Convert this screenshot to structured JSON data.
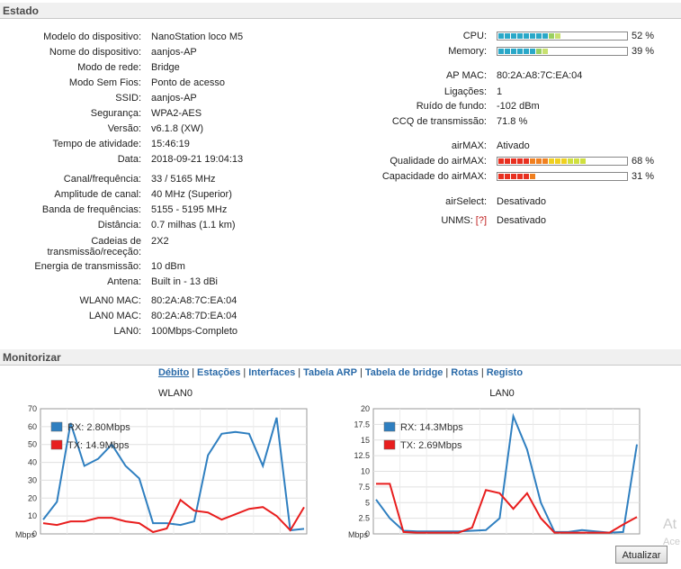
{
  "status": {
    "title": "Estado",
    "left": [
      {
        "label": "Modelo do dispositivo:",
        "value": "NanoStation loco M5"
      },
      {
        "label": "Nome do dispositivo:",
        "value": "aanjos-AP"
      },
      {
        "label": "Modo de rede:",
        "value": "Bridge"
      },
      {
        "label": "Modo Sem Fios:",
        "value": "Ponto de acesso"
      },
      {
        "label": "SSID:",
        "value": "aanjos-AP"
      },
      {
        "label": "Segurança:",
        "value": "WPA2-AES"
      },
      {
        "label": "Versão:",
        "value": "v6.1.8 (XW)"
      },
      {
        "label": "Tempo de atividade:",
        "value": "15:46:19"
      },
      {
        "label": "Data:",
        "value": "2018-09-21 19:04:13"
      },
      {
        "label": "Canal/frequência:",
        "value": "33 / 5165 MHz"
      },
      {
        "label": "Amplitude de canal:",
        "value": "40 MHz (Superior)"
      },
      {
        "label": "Banda de frequências:",
        "value": "5155 - 5195 MHz"
      },
      {
        "label": "Distância:",
        "value": "0.7 milhas (1.1 km)"
      },
      {
        "label": "Cadeias de",
        "label2": "transmissão/receção:",
        "value": "2X2"
      },
      {
        "label": "Energia de transmissão:",
        "value": "10 dBm"
      },
      {
        "label": "Antena:",
        "value": "Built in - 13 dBi"
      },
      {
        "label": "WLAN0 MAC:",
        "value": "80:2A:A8:7C:EA:04"
      },
      {
        "label": "LAN0 MAC:",
        "value": "80:2A:A8:7D:EA:04"
      },
      {
        "label": "LAN0:",
        "value": "100Mbps-Completo"
      }
    ],
    "cpu": {
      "label": "CPU:",
      "percent_text": "52 %",
      "percent": 52
    },
    "memory": {
      "label": "Memory:",
      "percent_text": "39 %",
      "percent": 39
    },
    "right": [
      {
        "label": "AP MAC:",
        "value": "80:2A:A8:7C:EA:04"
      },
      {
        "label": "Ligações:",
        "value": "1"
      },
      {
        "label": "Ruído de fundo:",
        "value": "-102 dBm"
      },
      {
        "label": "CCQ de transmissão:",
        "value": "71.8 %"
      },
      {
        "label": "airMAX:",
        "value": "Ativado"
      }
    ],
    "airmax_quality": {
      "label": "Qualidade do airMAX:",
      "percent_text": "68 %",
      "percent": 68
    },
    "airmax_capacity": {
      "label": "Capacidade do airMAX:",
      "percent_text": "31 %",
      "percent": 31
    },
    "airselect": {
      "label": "airSelect:",
      "value": "Desativado"
    },
    "unms": {
      "label": "UNMS:",
      "help": "[?]",
      "value": "Desativado"
    }
  },
  "monitor": {
    "title": "Monitorizar",
    "tabs": [
      "Débito",
      "Estações",
      "Interfaces",
      "Tabela ARP",
      "Tabela de bridge",
      "Rotas",
      "Registo"
    ],
    "refresh_button": "Atualizar",
    "faded_text": "At",
    "faded_text2": "Ace"
  },
  "chart_data": [
    {
      "type": "line",
      "title": "WLAN0",
      "ylabel": "Mbps",
      "ylim": [
        0,
        70
      ],
      "yticks": [
        "0",
        "10",
        "20",
        "30",
        "40",
        "50",
        "60",
        "70"
      ],
      "series": [
        {
          "name": "RX: 2.80Mbps",
          "color": "#2f7fc0",
          "values": [
            8,
            18,
            62,
            38,
            42,
            50,
            38,
            31,
            6,
            6,
            5,
            7,
            44,
            56,
            57,
            56,
            38,
            65,
            2,
            2.8
          ]
        },
        {
          "name": "TX: 14.9Mbps",
          "color": "#e81e1e",
          "values": [
            6,
            5,
            7,
            7,
            9,
            9,
            7,
            6,
            1,
            3,
            19,
            13,
            12,
            8,
            11,
            14,
            15,
            10,
            2,
            14.9
          ]
        }
      ]
    },
    {
      "type": "line",
      "title": "LAN0",
      "ylabel": "Mbps",
      "ylim": [
        0,
        20
      ],
      "yticks": [
        "0",
        "2.5",
        "5",
        "7.5",
        "10",
        "12.5",
        "15",
        "17.5",
        "20"
      ],
      "series": [
        {
          "name": "RX: 14.3Mbps",
          "color": "#2f7fc0",
          "values": [
            5.5,
            2.5,
            0.5,
            0.4,
            0.4,
            0.4,
            0.4,
            0.5,
            0.6,
            2.5,
            18.8,
            13.5,
            5,
            0.3,
            0.3,
            0.6,
            0.4,
            0.2,
            0.3,
            14.3
          ]
        },
        {
          "name": "TX: 2.69Mbps",
          "color": "#e81e1e",
          "values": [
            8,
            8,
            0.3,
            0.2,
            0.2,
            0.2,
            0.2,
            1,
            7,
            6.5,
            4,
            6.5,
            2.5,
            0.2,
            0.2,
            0.2,
            0.2,
            0.2,
            1.5,
            2.69
          ]
        }
      ]
    }
  ]
}
